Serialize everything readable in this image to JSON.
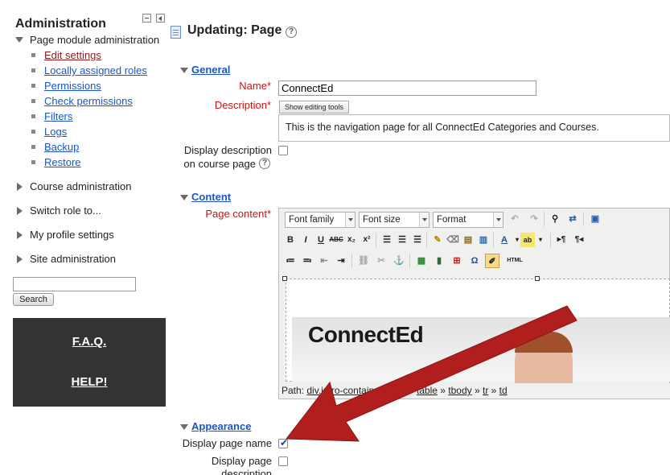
{
  "sidebar": {
    "title": "Administration",
    "page_module": {
      "label": "Page module administration",
      "items": [
        {
          "label": "Edit settings",
          "active": true
        },
        {
          "label": "Locally assigned roles"
        },
        {
          "label": "Permissions"
        },
        {
          "label": "Check permissions"
        },
        {
          "label": "Filters"
        },
        {
          "label": "Logs"
        },
        {
          "label": "Backup"
        },
        {
          "label": "Restore"
        }
      ]
    },
    "nodes": [
      {
        "label": "Course administration"
      },
      {
        "label": "Switch role to..."
      },
      {
        "label": "My profile settings"
      },
      {
        "label": "Site administration"
      }
    ],
    "search": {
      "value": "",
      "button_label": "Search"
    },
    "links_box": {
      "faq_label": "F.A.Q.",
      "help_label": "HELP!"
    }
  },
  "main": {
    "title": "Updating: Page",
    "general": {
      "heading": "General",
      "name_label": "Name",
      "name_value": "ConnectEd",
      "description_label": "Description",
      "show_editing_tools": "Show editing tools",
      "description_value": "This is the navigation page for all ConnectEd Categories and Courses.",
      "display_description_label_line1": "Display description",
      "display_description_label_line2": "on course page",
      "display_description_checked": false
    },
    "content": {
      "heading": "Content",
      "page_content_label": "Page content",
      "font_family": "Font family",
      "font_size": "Font size",
      "format": "Format",
      "html_button": "HTML",
      "banner_text": "ConnectEd",
      "path_label": "Path:",
      "path_items": [
        "div.intro-container",
        "div",
        "table",
        "tbody",
        "tr",
        "td"
      ]
    },
    "appearance": {
      "heading": "Appearance",
      "display_page_name_label": "Display page name",
      "display_page_name_checked": true,
      "display_page_description_line1": "Display page",
      "display_page_description_line2": "description"
    },
    "required_marker": "*",
    "help_marker": "?"
  },
  "colors": {
    "link": "#1a56c9",
    "required": "#c81212",
    "active_link": "#8b1a1a",
    "annotation_arrow": "#b01e1e",
    "links_box_bg": "#333333"
  }
}
